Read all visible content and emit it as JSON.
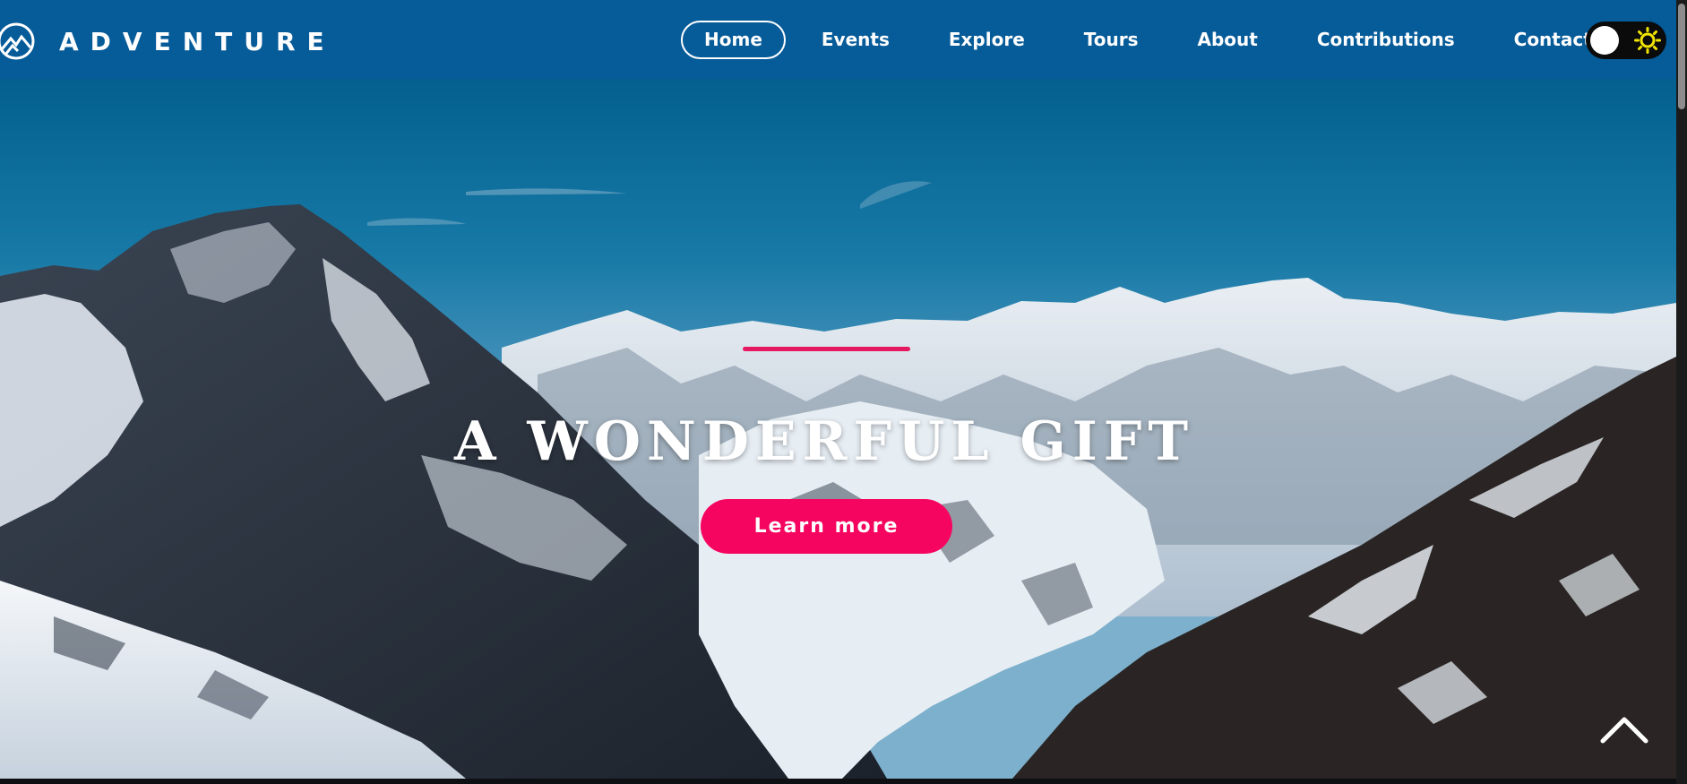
{
  "brand": {
    "name": "ADVENTURE",
    "logo_icon": "mountain-circle-icon"
  },
  "nav": {
    "items": [
      {
        "label": "Home",
        "active": true
      },
      {
        "label": "Events",
        "active": false
      },
      {
        "label": "Explore",
        "active": false
      },
      {
        "label": "Tours",
        "active": false
      },
      {
        "label": "About",
        "active": false
      },
      {
        "label": "Contributions",
        "active": false
      },
      {
        "label": "Contact",
        "active": false
      }
    ],
    "theme_toggle": {
      "icon": "sun-icon",
      "state": "light"
    }
  },
  "hero": {
    "title": "A WONDERFUL GIFT",
    "button_label": "Learn more",
    "accent_color": "#e5195f",
    "button_color": "#f5055f"
  },
  "scroll_top": {
    "icon": "chevron-up-icon"
  },
  "colors": {
    "navbar": "#065b99",
    "toggle_sun": "#f2e600"
  }
}
